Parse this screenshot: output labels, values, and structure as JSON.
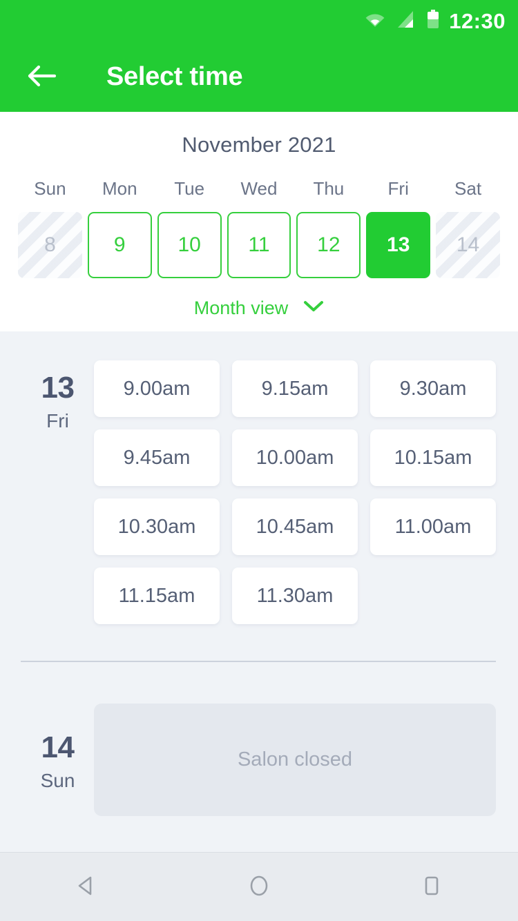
{
  "status_bar": {
    "time": "12:30",
    "icons": [
      "wifi-icon",
      "signal-icon",
      "battery-icon"
    ]
  },
  "app_bar": {
    "back_icon": "arrow-left-icon",
    "title": "Select time"
  },
  "theme": {
    "brand_green": "#22cc33",
    "outline_green": "#35cf3d",
    "page_bg": "#f0f3f7",
    "card_bg": "#ffffff",
    "text_dark": "#4c5670",
    "text_muted": "#a4abb9",
    "closed_bg": "#e4e8ee"
  },
  "calendar": {
    "month_title": "November 2021",
    "weekday_headers": [
      "Sun",
      "Mon",
      "Tue",
      "Wed",
      "Thu",
      "Fri",
      "Sat"
    ],
    "days": [
      {
        "label": "8",
        "state": "disabled"
      },
      {
        "label": "9",
        "state": "available"
      },
      {
        "label": "10",
        "state": "available"
      },
      {
        "label": "11",
        "state": "available"
      },
      {
        "label": "12",
        "state": "available"
      },
      {
        "label": "13",
        "state": "selected"
      },
      {
        "label": "14",
        "state": "disabled"
      }
    ],
    "month_view_label": "Month view",
    "month_view_icon": "chevron-down-icon"
  },
  "schedule": [
    {
      "day_number": "13",
      "day_name": "Fri",
      "slots": [
        "9.00am",
        "9.15am",
        "9.30am",
        "9.45am",
        "10.00am",
        "10.15am",
        "10.30am",
        "10.45am",
        "11.00am",
        "11.15am",
        "11.30am"
      ]
    },
    {
      "day_number": "14",
      "day_name": "Sun",
      "closed_message": "Salon closed"
    }
  ],
  "nav_bar": {
    "back_icon": "triangle-back-icon",
    "home_icon": "circle-home-icon",
    "recents_icon": "square-recents-icon"
  }
}
